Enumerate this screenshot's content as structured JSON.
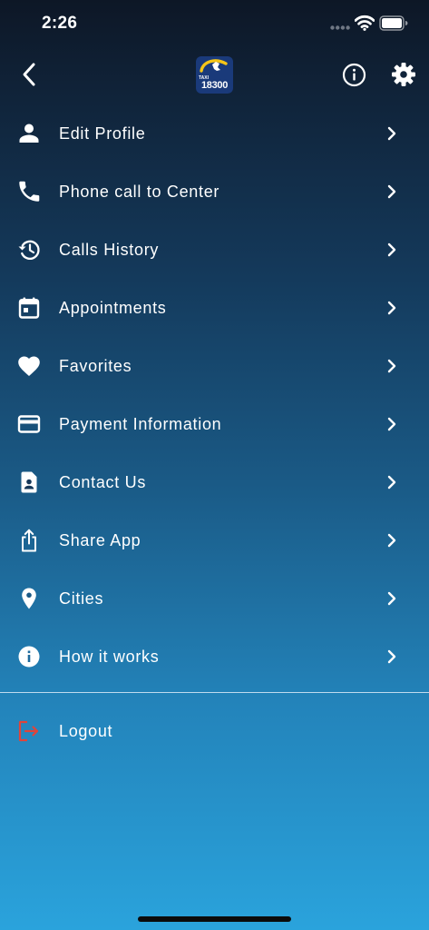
{
  "status_bar": {
    "time": "2:26",
    "icons": [
      "signal-icon",
      "wifi-icon",
      "battery-icon"
    ]
  },
  "header": {
    "logo": {
      "text_small": "TAXI",
      "text_number": "18300",
      "background": "#1a3a7a",
      "accent": "#f5c518"
    },
    "icons": [
      "back-arrow-icon",
      "info-icon",
      "gear-icon"
    ]
  },
  "menu": {
    "items": [
      {
        "label": "Edit Profile",
        "icon": "person-icon"
      },
      {
        "label": "Phone call to Center",
        "icon": "phone-icon"
      },
      {
        "label": "Calls History",
        "icon": "history-icon"
      },
      {
        "label": "Appointments",
        "icon": "calendar-icon"
      },
      {
        "label": "Favorites",
        "icon": "heart-icon"
      },
      {
        "label": "Payment Information",
        "icon": "credit-card-icon"
      },
      {
        "label": "Contact Us",
        "icon": "contact-document-icon"
      },
      {
        "label": "Share App",
        "icon": "share-icon"
      },
      {
        "label": "Cities",
        "icon": "location-pin-icon"
      },
      {
        "label": "How it works",
        "icon": "info-filled-icon"
      }
    ]
  },
  "logout": {
    "label": "Logout",
    "icon": "logout-icon",
    "icon_color": "#e0443a"
  },
  "colors": {
    "gradient_top": "#0d1726",
    "gradient_bottom": "#2aa3dc",
    "text": "#ffffff"
  }
}
